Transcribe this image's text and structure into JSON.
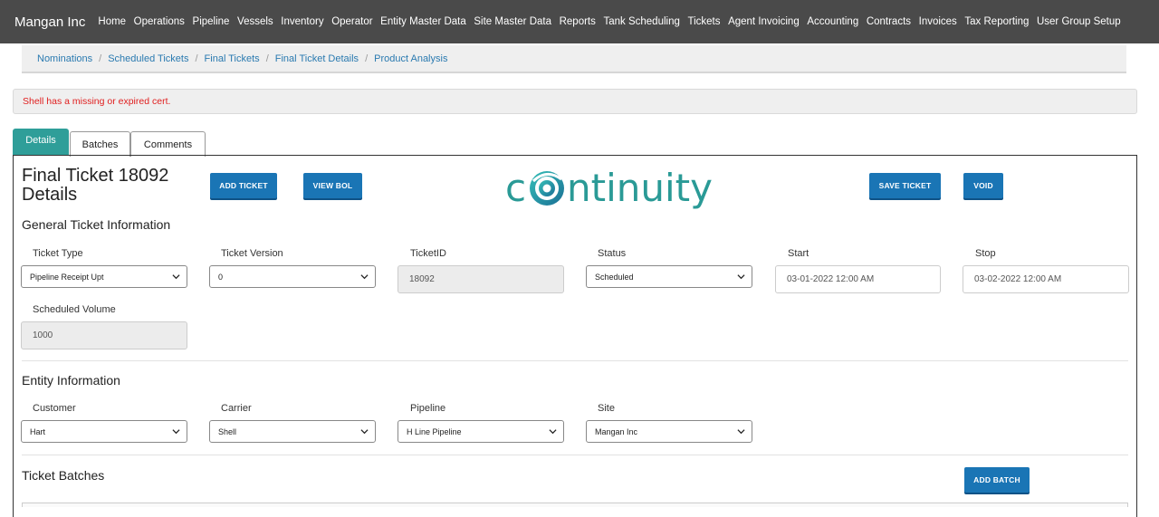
{
  "nav": {
    "brand": "Mangan Inc",
    "items": [
      "Home",
      "Operations",
      "Pipeline",
      "Vessels",
      "Inventory",
      "Operator",
      "Entity Master Data",
      "Site Master Data",
      "Reports",
      "Tank Scheduling",
      "Tickets",
      "Agent Invoicing",
      "Accounting",
      "Contracts",
      "Invoices",
      "Tax Reporting",
      "User Group Setup"
    ]
  },
  "breadcrumb": [
    "Nominations",
    "Scheduled Tickets",
    "Final Tickets",
    "Final Ticket Details",
    "Product Analysis"
  ],
  "alert": "Shell has a missing or expired cert.",
  "tabs": {
    "details": "Details",
    "batches": "Batches",
    "comments": "Comments"
  },
  "header": {
    "title_line1": "Final Ticket 18092",
    "title_line2": "Details",
    "add_ticket": "ADD TICKET",
    "view_bol": "VIEW BOL",
    "save_ticket": "SAVE TICKET",
    "void": "VOID",
    "logo_text": "continuity"
  },
  "general": {
    "title": "General Ticket Information",
    "ticket_type_label": "Ticket Type",
    "ticket_type": "Pipeline Receipt Upt",
    "ticket_version_label": "Ticket Version",
    "ticket_version": "0",
    "ticket_id_label": "TicketID",
    "ticket_id": "18092",
    "status_label": "Status",
    "status": "Scheduled",
    "start_label": "Start",
    "start": "03-01-2022 12:00 AM",
    "stop_label": "Stop",
    "stop": "03-02-2022 12:00 AM",
    "scheduled_volume_label": "Scheduled Volume",
    "scheduled_volume": "1000"
  },
  "entity": {
    "title": "Entity Information",
    "customer_label": "Customer",
    "customer": "Hart",
    "carrier_label": "Carrier",
    "carrier": "Shell",
    "pipeline_label": "Pipeline",
    "pipeline": "H Line Pipeline",
    "site_label": "Site",
    "site": "Mangan Inc"
  },
  "batches": {
    "title": "Ticket Batches",
    "add_batch": "ADD BATCH"
  },
  "colors": {
    "navbar": "#4a4a4a",
    "accent": "#2f9e99",
    "button": "#1a75b5",
    "alert_text": "#e02020",
    "link": "#2a7ab0"
  }
}
